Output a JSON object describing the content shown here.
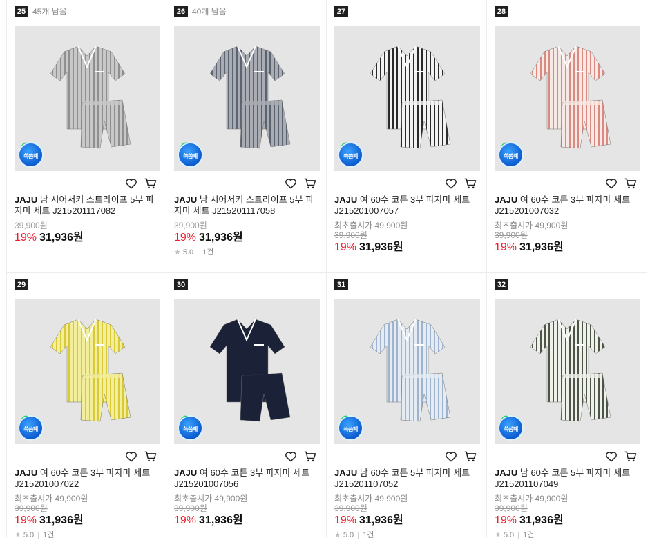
{
  "products": [
    {
      "rank": "25",
      "stock": "45개 남음",
      "brand": "JAJU",
      "name": "남 시어서커 스트라이프 5부 파자마 세트 J215201117082",
      "first_price": "",
      "orig_price": "39,900원",
      "discount": "19%",
      "price": "31,936원",
      "rating": "",
      "reviews": "",
      "badge": "쓱씀폐",
      "shirt_color": "#c8c8c8",
      "stripe_color": "#8f8f8f"
    },
    {
      "rank": "26",
      "stock": "40개 남음",
      "brand": "JAJU",
      "name": "남 시어서커 스트라이프 5부 파자마 세트 J215201117058",
      "first_price": "",
      "orig_price": "39,900원",
      "discount": "19%",
      "price": "31,936원",
      "rating": "5.0",
      "reviews": "1건",
      "badge": "쓱씀폐",
      "shirt_color": "#a9adb3",
      "stripe_color": "#5b6270"
    },
    {
      "rank": "27",
      "stock": "",
      "brand": "JAJU",
      "name": "여 60수 코튼 3부 파자마 세트 J215201007057",
      "first_price": "최초출시가 49,900원",
      "orig_price": "39,900원",
      "discount": "19%",
      "price": "31,936원",
      "rating": "",
      "reviews": "",
      "badge": "쓱씀폐",
      "shirt_color": "#f2f2f2",
      "stripe_color": "#2a2a2a"
    },
    {
      "rank": "28",
      "stock": "",
      "brand": "JAJU",
      "name": "여 60수 코튼 3부 파자마 세트 J215201007032",
      "first_price": "최초출시가 49,900원",
      "orig_price": "39,900원",
      "discount": "19%",
      "price": "31,936원",
      "rating": "",
      "reviews": "",
      "badge": "쓱씀폐",
      "shirt_color": "#f6e8e4",
      "stripe_color": "#d98b82"
    },
    {
      "rank": "29",
      "stock": "",
      "brand": "JAJU",
      "name": "여 60수 코튼 3부 파자마 세트 J215201007022",
      "first_price": "최초출시가 49,900원",
      "orig_price": "39,900원",
      "discount": "19%",
      "price": "31,936원",
      "rating": "5.0",
      "reviews": "1건",
      "badge": "쓱씀폐",
      "shirt_color": "#f3ee9c",
      "stripe_color": "#d8c93a"
    },
    {
      "rank": "30",
      "stock": "",
      "brand": "JAJU",
      "name": "여 60수 코튼 3부 파자마 세트 J215201007056",
      "first_price": "최초출시가 49,900원",
      "orig_price": "39,900원",
      "discount": "19%",
      "price": "31,936원",
      "rating": "",
      "reviews": "",
      "badge": "쓱씀폐",
      "shirt_color": "#1b2238",
      "stripe_color": "#1b2238"
    },
    {
      "rank": "31",
      "stock": "",
      "brand": "JAJU",
      "name": "남 60수 코튼 5부 파자마 세트 J215201107052",
      "first_price": "최초출시가 49,900원",
      "orig_price": "39,900원",
      "discount": "19%",
      "price": "31,936원",
      "rating": "5.0",
      "reviews": "1건",
      "badge": "쓱씀폐",
      "shirt_color": "#e4ebf3",
      "stripe_color": "#9fb3cc"
    },
    {
      "rank": "32",
      "stock": "",
      "brand": "JAJU",
      "name": "남 60수 코튼 5부 파자마 세트 J215201107049",
      "first_price": "최초출시가 49,900원",
      "orig_price": "39,900원",
      "discount": "19%",
      "price": "31,936원",
      "rating": "5.0",
      "reviews": "1건",
      "badge": "쓱씀폐",
      "shirt_color": "#eef0ea",
      "stripe_color": "#4e5448"
    }
  ],
  "icons": {
    "wishlist": "heart-icon",
    "cart": "cart-icon",
    "star": "★"
  }
}
